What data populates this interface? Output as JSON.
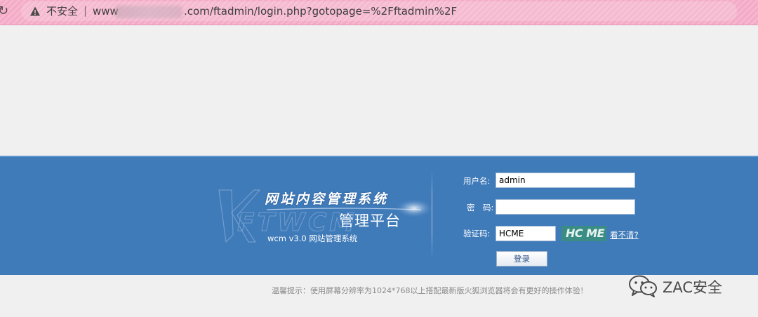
{
  "browser": {
    "security_label": "不安全",
    "separator": "|",
    "url_prefix": "www",
    "url_rest": ".com/ftadmin/login.php?gotopage=%2Fftadmin%2F"
  },
  "brand": {
    "title": "网站内容管理系统",
    "subtitle": "管理平台",
    "logo_text": "FTWCM",
    "version": "wcm v3.0 网站管理系统"
  },
  "form": {
    "username_label": "用户名:",
    "username_value": "admin",
    "password_label": "密　码:",
    "password_value": "",
    "captcha_label": "验证码:",
    "captcha_value": "HCME",
    "captcha_image_text": "HC ME",
    "refresh_link": "看不清?",
    "login_button": "登录"
  },
  "footer": {
    "tip": "温馨提示：使用屏幕分辨率为1024*768以上搭配最新版火狐浏览器将会有更好的操作体验！"
  },
  "watermark": {
    "text": "ZAC安全"
  }
}
